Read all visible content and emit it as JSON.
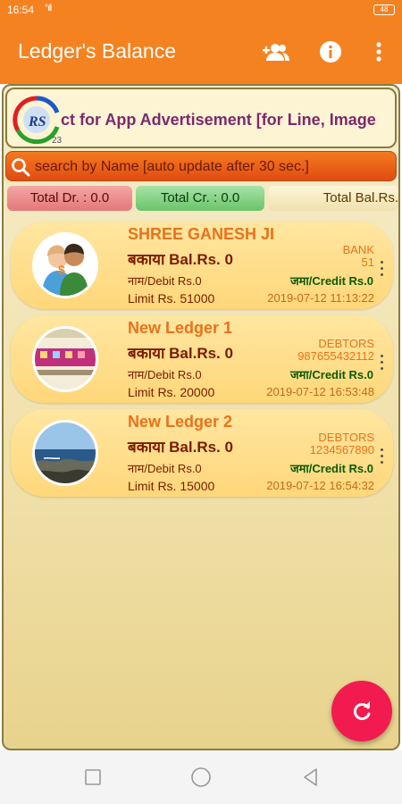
{
  "status_bar": {
    "time": "16:54",
    "signal": "°ıll",
    "battery": "48"
  },
  "app_bar": {
    "title": "Ledger's Balance",
    "icons": [
      "add-group-icon",
      "info-icon",
      "more-vert-icon"
    ]
  },
  "ad_banner": {
    "text": "ct for App Advertisement [for Line, Image",
    "logo_letters": "RS",
    "count": "23"
  },
  "search": {
    "placeholder": "search by Name [auto update after 30 sec.]",
    "value": ""
  },
  "totals": {
    "debit": "Total Dr. : 0.0",
    "credit": "Total Cr. : 0.0",
    "balance": "Total Bal.Rs."
  },
  "ledgers": [
    {
      "name": "SHREE GANESH JI",
      "balance": "बकाया Bal.Rs. 0",
      "debit": "नाम/Debit Rs.0",
      "limit": "Limit Rs. 51000",
      "group": "BANK",
      "mobile": "51",
      "credit": "जमा/Credit Rs.0",
      "date": "2019-07-12 11:13:22",
      "avatar": "people-photo"
    },
    {
      "name": "New Ledger 1",
      "balance": "बकाया Bal.Rs. 0",
      "debit": "नाम/Debit Rs.0",
      "limit": "Limit Rs. 20000",
      "group": "DEBTORS",
      "mobile": "987655432112",
      "credit": "जमा/Credit Rs.0",
      "date": "2019-07-12 16:53:48",
      "avatar": "app-screenshot-photo"
    },
    {
      "name": "New Ledger 2",
      "balance": "बकाया Bal.Rs. 0",
      "debit": "नाम/Debit Rs.0",
      "limit": "Limit Rs. 15000",
      "group": "DEBTORS",
      "mobile": "1234567890",
      "credit": "जमा/Credit Rs.0",
      "date": "2019-07-12 16:54:32",
      "avatar": "seashore-photo"
    }
  ],
  "fab": {
    "icon": "refresh-icon"
  },
  "nav_bar": {
    "icons": [
      "recents-square-icon",
      "home-circle-icon",
      "back-triangle-icon"
    ]
  },
  "colors": {
    "primary": "#f58220",
    "fab": "#f21b4f",
    "card": "#ffd77a",
    "name": "#e8731c"
  }
}
